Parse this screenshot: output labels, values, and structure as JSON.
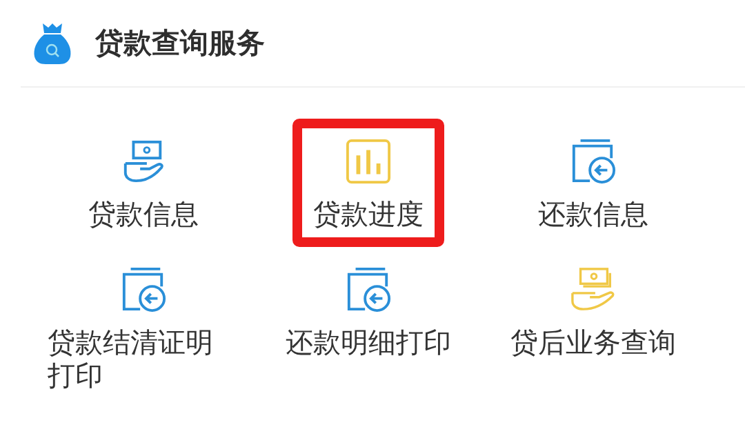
{
  "header": {
    "title": "贷款查询服务"
  },
  "services": [
    {
      "label": "贷款信息",
      "kind": "hand-cash",
      "color": "#2a8fd8",
      "highlighted": false
    },
    {
      "label": "贷款进度",
      "kind": "chart",
      "color": "#f0c846",
      "highlighted": true
    },
    {
      "label": "还款信息",
      "kind": "refund",
      "color": "#2a8fd8",
      "highlighted": false
    },
    {
      "label": "贷款结清证明打印",
      "kind": "refund",
      "color": "#2a8fd8",
      "highlighted": false
    },
    {
      "label": "还款明细打印",
      "kind": "refund",
      "color": "#2a8fd8",
      "highlighted": false
    },
    {
      "label": "贷后业务查询",
      "kind": "hand-cash-stack",
      "color": "#f0c846",
      "highlighted": false
    }
  ]
}
